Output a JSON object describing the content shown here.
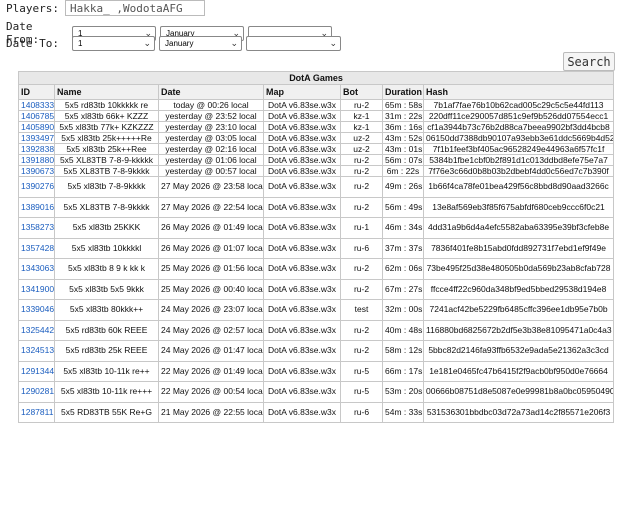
{
  "form": {
    "players_label": "Players:",
    "players_value": "Hakka_ ,WodotaAFG",
    "date_from_label": "Date From:",
    "date_to_label": "Date To:",
    "from_day": "1",
    "from_month": "January",
    "from_year": "",
    "to_day": "1",
    "to_month": "January",
    "to_year": "",
    "search_label": "Search"
  },
  "table": {
    "caption": "DotA Games",
    "columns": [
      "ID",
      "Name",
      "Date",
      "Map",
      "Bot",
      "Duration",
      "Hash"
    ],
    "rows": [
      {
        "id": "1408333",
        "name": "5x5 rd83tb 10kkkkk re",
        "date": "today @ 00:26 local",
        "map": "DotA v6.83se.w3x",
        "bot": "ru-2",
        "duration": "65m : 58s",
        "hash": "7b1af7fae76b10b62cad005c29c5c5e44fd113"
      },
      {
        "id": "1406785",
        "name": "5x5 xl83tb 66k+ KZZZ",
        "date": "yesterday @ 23:52 local",
        "map": "DotA v6.83se.w3x",
        "bot": "kz-1",
        "duration": "31m : 22s",
        "hash": "220dff11ce290057d851c9ef9b526dd07554ecc1"
      },
      {
        "id": "1405890",
        "name": "5x5 xl83tb 77k+ KZKZZZ",
        "date": "yesterday @ 23:10 local",
        "map": "DotA v6.83se.w3x",
        "bot": "kz-1",
        "duration": "36m : 16s",
        "hash": "cf1a3944b73c76b2d88ca7beea9902bf3dd4bcb8"
      },
      {
        "id": "1393497",
        "name": "5x5 xl83tb 25k+++++Re",
        "date": "yesterday @ 03:05 local",
        "map": "DotA v6.83se.w3x",
        "bot": "uz-2",
        "duration": "43m : 52s",
        "hash": "06150dd7388db90107a93ebb3e61ddc5669b4d52"
      },
      {
        "id": "1392838",
        "name": "5x5 xl83tb 25k++Ree",
        "date": "yesterday @ 02:16 local",
        "map": "DotA v6.83se.w3x",
        "bot": "uz-2",
        "duration": "43m : 01s",
        "hash": "7f1b1feef3bf405ac96528249e44963a6f57fc1f"
      },
      {
        "id": "1391880",
        "name": "5x5 XL83TB 7-8-9-kkkkk",
        "date": "yesterday @ 01:06 local",
        "map": "DotA v6.83se.w3x",
        "bot": "ru-2",
        "duration": "56m : 07s",
        "hash": "5384b1fbe1cbf0b2f891d1c013ddbd8efe75e7a7"
      },
      {
        "id": "1390673",
        "name": "5x5 XL83TB 7-8-9kkkk",
        "date": "yesterday @ 00:57 local",
        "map": "DotA v6.83se.w3x",
        "bot": "ru-2",
        "duration": "6m : 22s",
        "hash": "7f76e3c66d0b8b03b2dbebf4dd0c56ed7c7b390f"
      },
      {
        "id": "1390276",
        "name": "5x5 xl83tb 7-8-9kkkk",
        "date": "27 May 2026 @ 23:58 local",
        "map": "DotA v6.83se.w3x",
        "bot": "ru-2",
        "duration": "49m : 26s",
        "hash": "1b66f4ca78fe01bea429f56c8bbd8d90aad3266c"
      },
      {
        "id": "1389016",
        "name": "5x5 XL83TB 7-8-9kkkk",
        "date": "27 May 2026 @ 22:54 local",
        "map": "DotA v6.83se.w3x",
        "bot": "ru-2",
        "duration": "56m : 49s",
        "hash": "13e8af569eb3f85f675abfdf680ceb9ccc6f0c21"
      },
      {
        "id": "1358273",
        "name": "5x5 xl83tb 25KKK",
        "date": "26 May 2026 @ 01:49 local",
        "map": "DotA v6.83se.w3x",
        "bot": "ru-1",
        "duration": "46m : 34s",
        "hash": "4dd31a9b6d4a4efc5582aba63395e39bf3cfeb8e"
      },
      {
        "id": "1357428",
        "name": "5x5 xl83tb 10kkkkl",
        "date": "26 May 2026 @ 01:07 local",
        "map": "DotA v6.83se.w3x",
        "bot": "ru-6",
        "duration": "37m : 37s",
        "hash": "7836f401fe8b15abd0fdd892731f7ebd1ef9f49e"
      },
      {
        "id": "1343063",
        "name": "5x5 xl83tb 8 9 k kk k",
        "date": "25 May 2026 @ 01:56 local",
        "map": "DotA v6.83se.w3x",
        "bot": "ru-2",
        "duration": "62m : 06s",
        "hash": "73be495f25d38e480505b0da569b23ab8cfab728"
      },
      {
        "id": "1341900",
        "name": "5x5 xl83tb 5x5 9kkk",
        "date": "25 May 2026 @ 00:40 local",
        "map": "DotA v6.83se.w3x",
        "bot": "ru-2",
        "duration": "67m : 27s",
        "hash": "ffcce4ff22c960da348bf9ed5bbed29538d194e8"
      },
      {
        "id": "1339046",
        "name": "5x5 xl83tb 80kkk++",
        "date": "24 May 2026 @ 23:07 local",
        "map": "DotA v6.83se.w3x",
        "bot": "test",
        "duration": "32m : 00s",
        "hash": "7241acf42be5229fb6485cffc396ee1db95e7b0b"
      },
      {
        "id": "1325442",
        "name": "5x5 rd83tb 60k REEE",
        "date": "24 May 2026 @ 02:57 local",
        "map": "DotA v6.83se.w3x",
        "bot": "ru-2",
        "duration": "40m : 48s",
        "hash": "116880bd6825672b2df5e3b38e81095471a0c4a3"
      },
      {
        "id": "1324513",
        "name": "5x5 rd83tb 25k REEE",
        "date": "24 May 2026 @ 01:47 local",
        "map": "DotA v6.83se.w3x",
        "bot": "ru-2",
        "duration": "58m : 12s",
        "hash": "5bbc82d2146fa93ffb6532e9ada5e21362a3c3cd"
      },
      {
        "id": "1291344",
        "name": "5x5 xl83tb 10-11k re++",
        "date": "22 May 2026 @ 01:49 local",
        "map": "DotA v6.83se.w3x",
        "bot": "ru-5",
        "duration": "66m : 17s",
        "hash": "1e181e0465fc47b6415f2f9acb0bf950d0e76664"
      },
      {
        "id": "1290281",
        "name": "5x5 xl83tb 10-11k re+++",
        "date": "22 May 2026 @ 00:54 local",
        "map": "DotA v6.83se.w3x",
        "bot": "ru-5",
        "duration": "53m : 20s",
        "hash": "00666b08751d8e5087e0e99981b8a0bc05950490"
      },
      {
        "id": "1287811",
        "name": "5x5 RD83TB 55K Re+G",
        "date": "21 May 2026 @ 22:55 local",
        "map": "DotA v6.83se.w3x",
        "bot": "ru-6",
        "duration": "54m : 33s",
        "hash": "531536301bbdbc03d72a73ad14c2f85571e206f3"
      }
    ]
  }
}
